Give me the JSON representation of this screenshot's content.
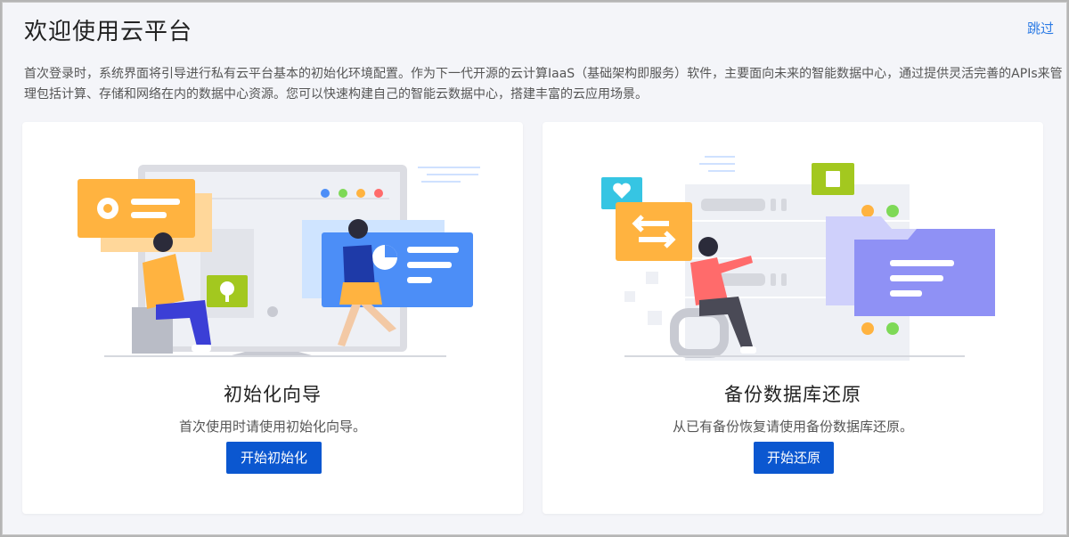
{
  "header": {
    "title": "欢迎使用云平台",
    "skip_label": "跳过"
  },
  "intro": {
    "text": "首次登录时，系统界面将引导进行私有云平台基本的初始化环境配置。作为下一代开源的云计算IaaS（基础架构即服务）软件，主要面向未来的智能数据中心，通过提供灵活完善的APIs来管理包括计算、存储和网络在内的数据中心资源。您可以快速构建自己的智能云数据中心，搭建丰富的云应用场景。"
  },
  "cards": [
    {
      "title": "初始化向导",
      "description": "首次使用时请使用初始化向导。",
      "button_label": "开始初始化",
      "illustration": "setup-wizard-illustration"
    },
    {
      "title": "备份数据库还原",
      "description": "从已有备份恢复请使用备份数据库还原。",
      "button_label": "开始还原",
      "illustration": "database-restore-illustration"
    }
  ],
  "colors": {
    "accent": "#0b57d0",
    "link": "#2c7be5",
    "orange": "#ffb340",
    "blue": "#4c8ef7",
    "purple": "#8f91f5",
    "green": "#a3c81f"
  }
}
